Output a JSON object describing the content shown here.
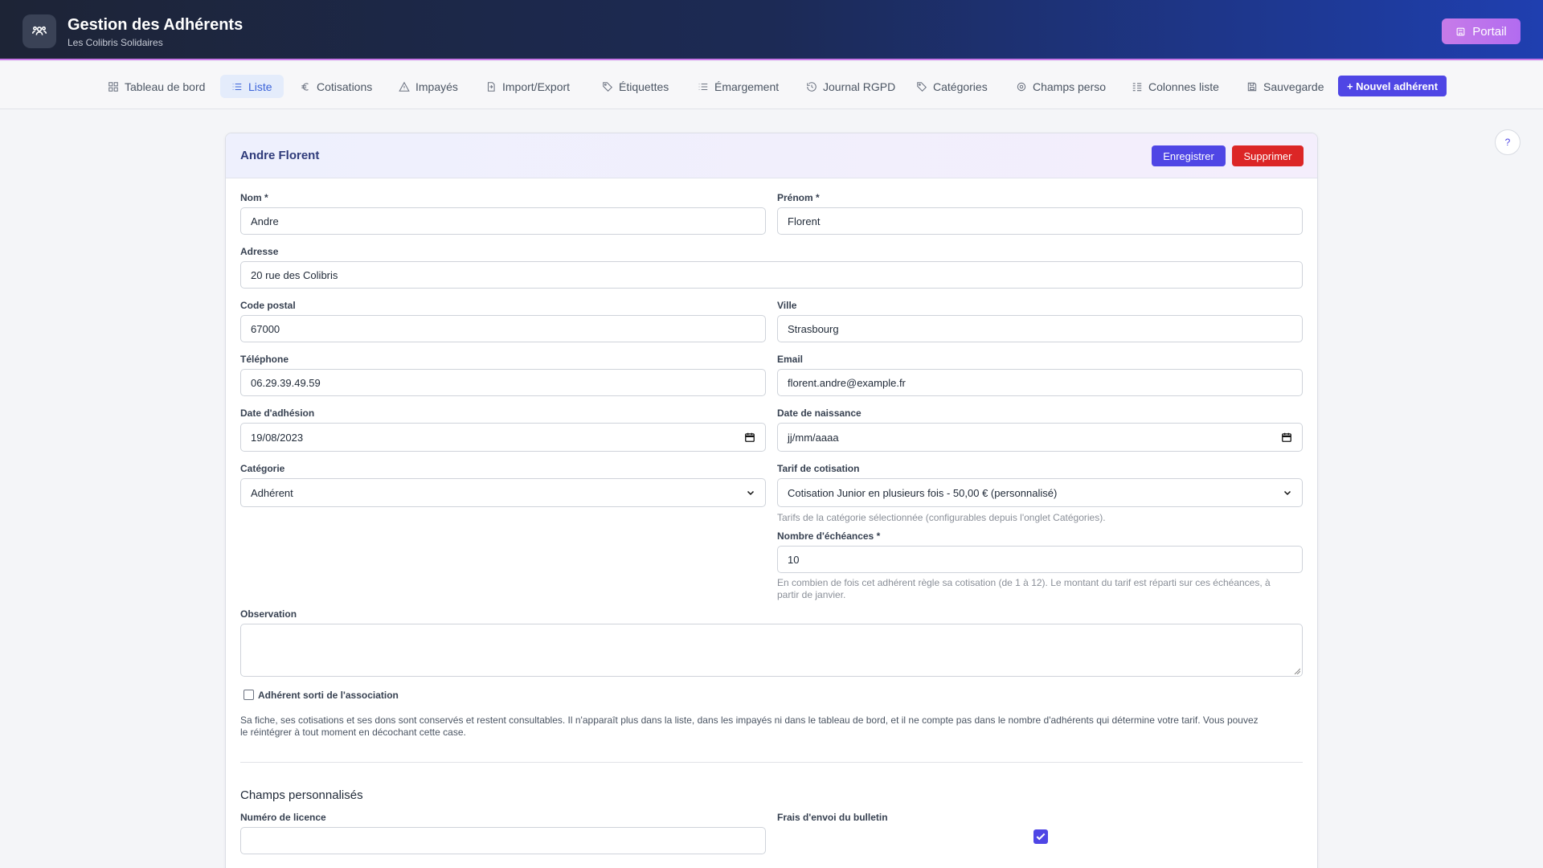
{
  "app": {
    "title": "Gestion des Adhérents",
    "subtitle": "Les Colibris Solidaires",
    "portal_label": "Portail"
  },
  "nav": {
    "items": [
      {
        "label": "Tableau de bord",
        "icon": "grid-icon"
      },
      {
        "label": "Liste",
        "icon": "list-icon",
        "active": true
      },
      {
        "label": "Cotisations",
        "icon": "euro-icon"
      },
      {
        "label": "Impayés",
        "icon": "warning-icon"
      },
      {
        "label": "Import/Export",
        "icon": "file-arrows-icon"
      },
      {
        "label": "Étiquettes",
        "icon": "tag-icon"
      },
      {
        "label": "Émargement",
        "icon": "list-icon"
      },
      {
        "label": "Journal RGPD",
        "icon": "history-icon"
      },
      {
        "label": "Catégories",
        "icon": "tag-icon"
      },
      {
        "label": "Champs perso",
        "icon": "gear-icon"
      },
      {
        "label": "Colonnes liste",
        "icon": "columns-icon"
      },
      {
        "label": "Sauvegarde",
        "icon": "save-icon"
      }
    ],
    "new_member_label": "+ Nouvel adhérent"
  },
  "help_label": "?",
  "form": {
    "title": "Andre Florent",
    "save_label": "Enregistrer",
    "delete_label": "Supprimer",
    "nom": {
      "label": "Nom *",
      "value": "Andre"
    },
    "prenom": {
      "label": "Prénom *",
      "value": "Florent"
    },
    "adresse": {
      "label": "Adresse",
      "value": "20 rue des Colibris"
    },
    "code_postal": {
      "label": "Code postal",
      "value": "67000"
    },
    "ville": {
      "label": "Ville",
      "value": "Strasbourg"
    },
    "telephone": {
      "label": "Téléphone",
      "value": "06.29.39.49.59"
    },
    "email": {
      "label": "Email",
      "value": "florent.andre@example.fr"
    },
    "date_adhesion": {
      "label": "Date d'adhésion",
      "value": "19/08/2023"
    },
    "date_naissance": {
      "label": "Date de naissance",
      "value": "jj/mm/aaaa"
    },
    "categorie": {
      "label": "Catégorie",
      "value": "Adhérent"
    },
    "tarif": {
      "label": "Tarif de cotisation",
      "value": "Cotisation Junior en plusieurs fois - 50,00 € (personnalisé)",
      "hint": "Tarifs de la catégorie sélectionnée (configurables depuis l'onglet Catégories)."
    },
    "echeances": {
      "label": "Nombre d'échéances *",
      "value": "10",
      "hint_line1": "En combien de fois cet adhérent règle sa cotisation (de 1 à 12). Le montant du tarif est réparti sur ces échéances, à",
      "hint_line2": "partir de janvier."
    },
    "observation": {
      "label": "Observation",
      "value": ""
    },
    "sorti": {
      "label": "Adhérent sorti de l'association",
      "checked": false,
      "desc_line1": "Sa fiche, ses cotisations et ses dons sont conservés et restent consultables. Il n'apparaît plus dans la liste, dans les impayés ni dans le tableau de bord, et il ne compte pas dans le nombre d'adhérents qui détermine votre tarif. Vous pouvez",
      "desc_line2": "le réintégrer à tout moment en décochant cette case."
    },
    "custom": {
      "title": "Champs personnalisés",
      "licence": {
        "label": "Numéro de licence",
        "value": ""
      },
      "frais": {
        "label": "Frais d'envoi du bulletin",
        "checked": true
      }
    }
  },
  "colors": {
    "accent": "#4f46e5",
    "danger": "#dc2626",
    "active_nav": "#3b63d9"
  }
}
